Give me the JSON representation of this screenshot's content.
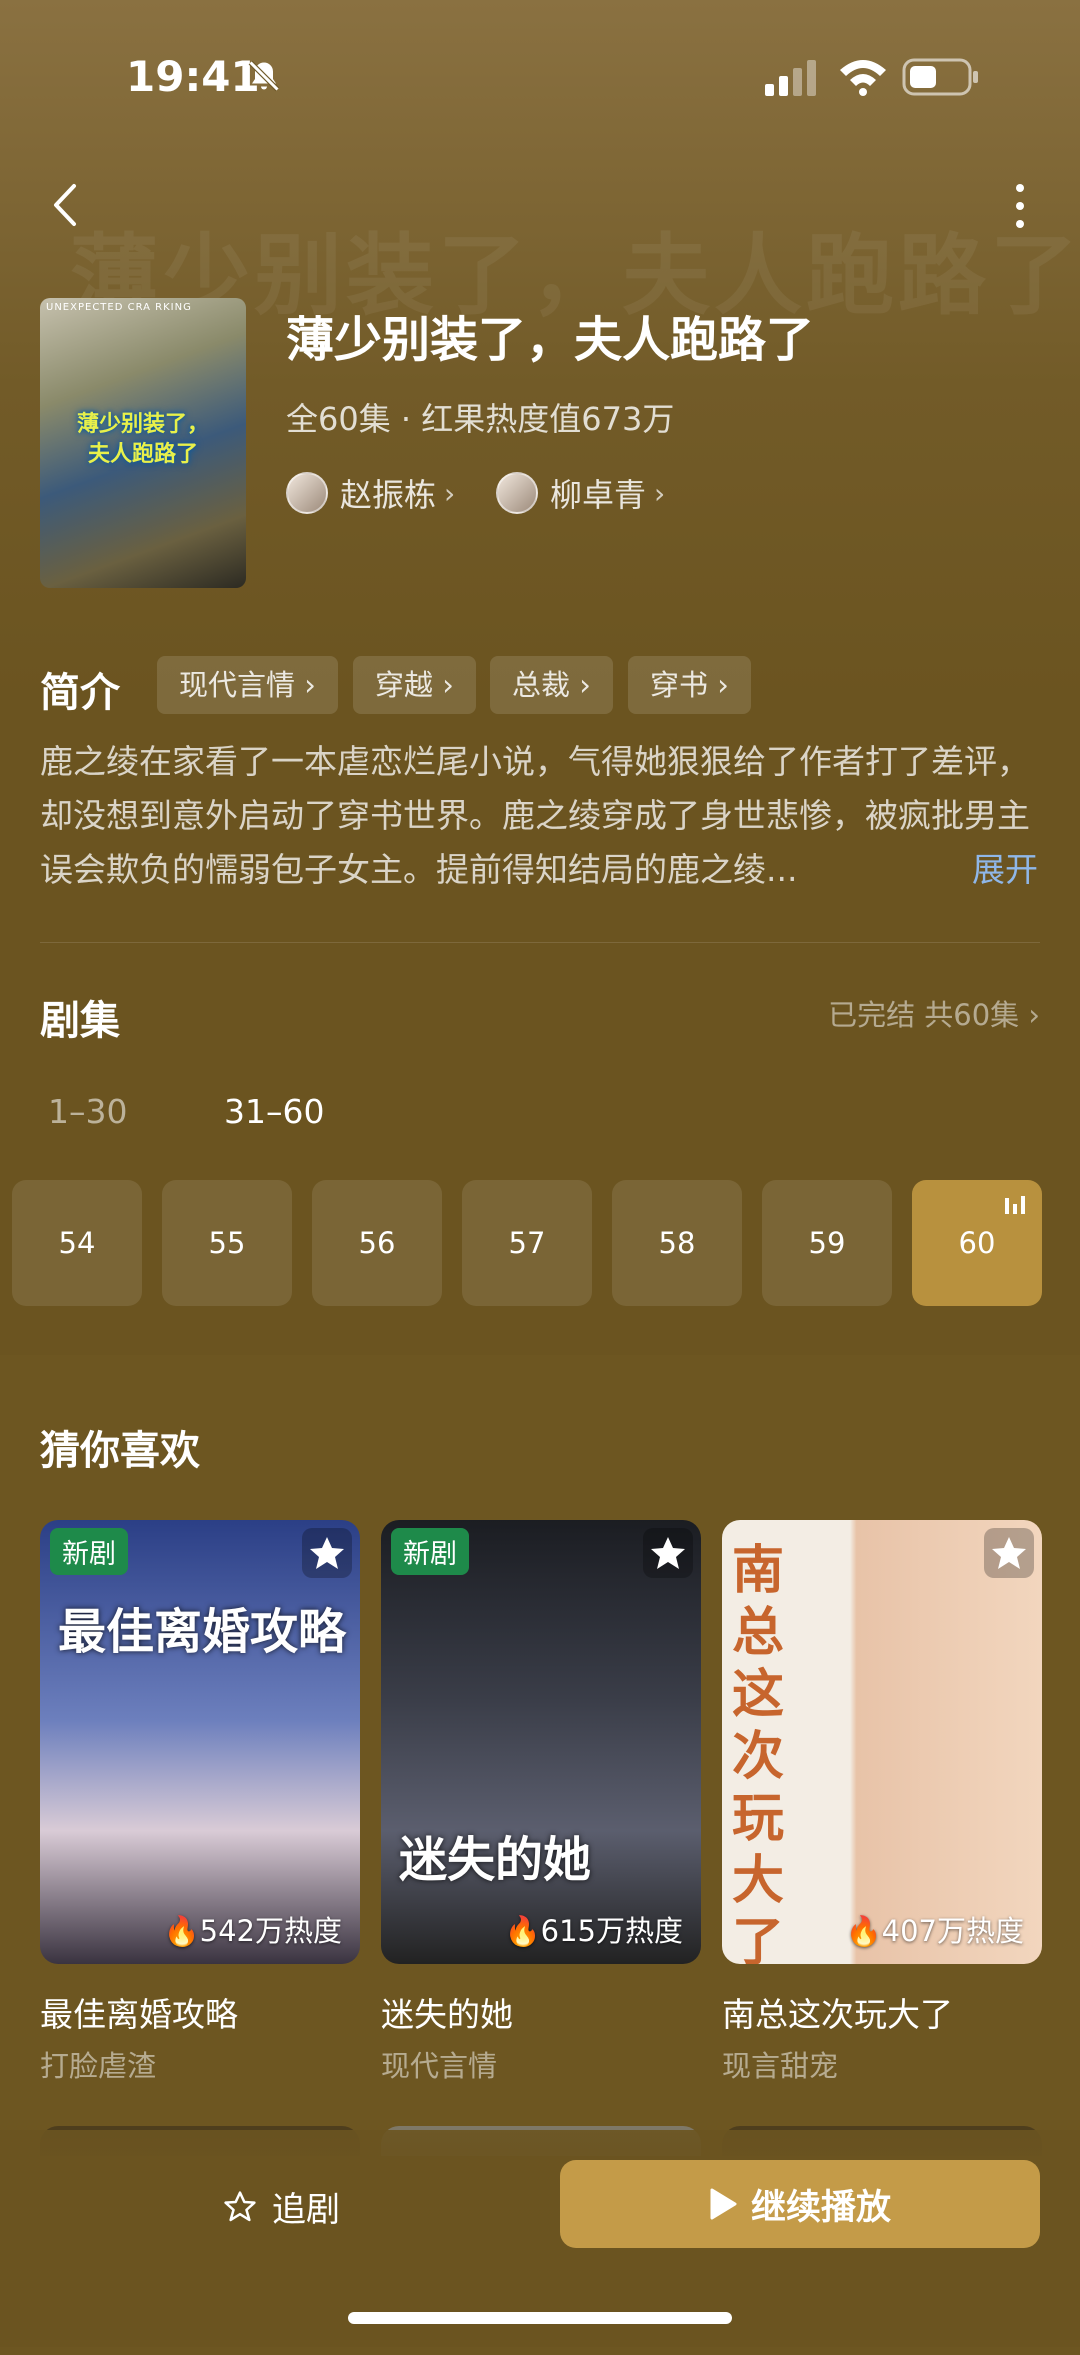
{
  "status_bar": {
    "time": "19:41"
  },
  "drama": {
    "title": "薄少别装了，夫人跑路了",
    "meta": "全60集 · 红果热度值673万",
    "cast": [
      {
        "name": "赵振栋"
      },
      {
        "name": "柳卓青"
      }
    ],
    "poster_top_text": "UNEXPECTED CRA    RKING",
    "poster_title_line1": "薄少别装了，",
    "poster_title_line2": "夫人跑路了"
  },
  "intro": {
    "heading": "简介",
    "tags": [
      "现代言情 ›",
      "穿越 ›",
      "总裁 ›",
      "穿书 ›"
    ],
    "description": "鹿之绫在家看了一本虐恋烂尾小说，气得她狠狠给了作者打了差评，却没想到意外启动了穿书世界。鹿之绫穿成了身世悲惨，被疯批男主误会欺负的懦弱包子女主。提前得知结局的鹿之绫...",
    "expand_label": "展开"
  },
  "episodes": {
    "heading": "剧集",
    "status": "已完结 共60集 ›",
    "ranges": [
      "1–30",
      "31–60"
    ],
    "selected_range": "31–60",
    "items": [
      "54",
      "55",
      "56",
      "57",
      "58",
      "59",
      "60"
    ],
    "current": "60"
  },
  "recommend": {
    "heading": "猜你喜欢",
    "cards": [
      {
        "badge": "新剧",
        "poster_title": "最佳离婚攻略",
        "heat": "542万热度",
        "name": "最佳离婚攻略",
        "genre": "打脸虐渣"
      },
      {
        "badge": "新剧",
        "poster_title": "迷失的她",
        "heat": "615万热度",
        "name": "迷失的她",
        "genre": "现代言情"
      },
      {
        "badge": "",
        "poster_title": "南总这次玩大了",
        "heat": "407万热度",
        "name": "南总这次玩大了",
        "genre": "现言甜宠"
      }
    ]
  },
  "bottom_bar": {
    "follow_label": "追剧",
    "play_label": "继续播放"
  }
}
